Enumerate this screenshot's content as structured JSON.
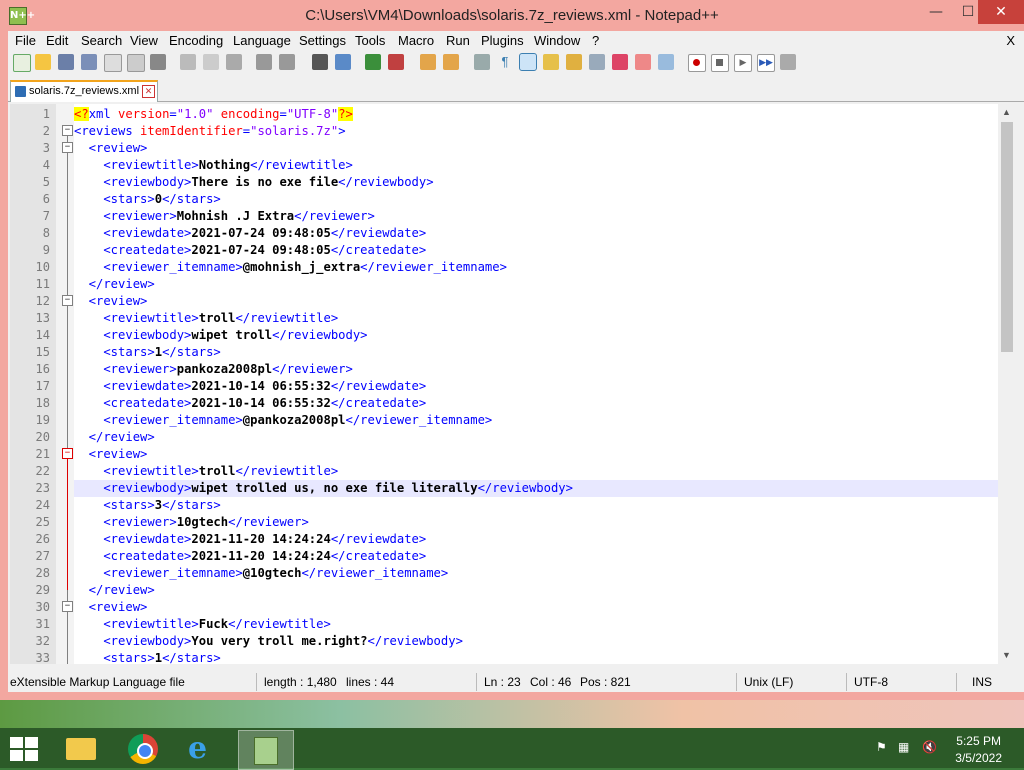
{
  "window": {
    "title": "C:\\Users\\VM4\\Downloads\\solaris.7z_reviews.xml - Notepad++",
    "app_icon": "N++",
    "controls": {
      "minimize": "—",
      "maximize": "☐",
      "close": "✕"
    }
  },
  "menu": {
    "items": [
      "File",
      "Edit",
      "Search",
      "View",
      "Encoding",
      "Language",
      "Settings",
      "Tools",
      "Macro",
      "Run",
      "Plugins",
      "Window",
      "?"
    ],
    "close_x": "X"
  },
  "tab": {
    "label": "solaris.7z_reviews.xml",
    "close": "✕"
  },
  "editor": {
    "highlighted_line": 23,
    "lines": [
      {
        "n": "1",
        "tokens": [
          [
            "pi",
            "<?"
          ],
          [
            "tag",
            "xml "
          ],
          [
            "attr",
            "version"
          ],
          [
            "tag",
            "="
          ],
          [
            "val",
            "\"1.0\""
          ],
          [
            "tag",
            " "
          ],
          [
            "attr",
            "encoding"
          ],
          [
            "tag",
            "="
          ],
          [
            "val",
            "\"UTF-8\""
          ],
          [
            "pi",
            "?>"
          ]
        ]
      },
      {
        "n": "2",
        "tokens": [
          [
            "tag",
            "<reviews "
          ],
          [
            "attr",
            "itemIdentifier"
          ],
          [
            "tag",
            "="
          ],
          [
            "val",
            "\"solaris.7z\""
          ],
          [
            "tag",
            ">"
          ]
        ]
      },
      {
        "n": "3",
        "tokens": [
          [
            "tag",
            "  <review>"
          ]
        ]
      },
      {
        "n": "4",
        "tokens": [
          [
            "tag",
            "    <reviewtitle>"
          ],
          [
            "txt",
            "Nothing"
          ],
          [
            "tag",
            "</reviewtitle>"
          ]
        ]
      },
      {
        "n": "5",
        "tokens": [
          [
            "tag",
            "    <reviewbody>"
          ],
          [
            "txt",
            "There is no exe file"
          ],
          [
            "tag",
            "</reviewbody>"
          ]
        ]
      },
      {
        "n": "6",
        "tokens": [
          [
            "tag",
            "    <stars>"
          ],
          [
            "txt",
            "0"
          ],
          [
            "tag",
            "</stars>"
          ]
        ]
      },
      {
        "n": "7",
        "tokens": [
          [
            "tag",
            "    <reviewer>"
          ],
          [
            "txt",
            "Mohnish .J Extra"
          ],
          [
            "tag",
            "</reviewer>"
          ]
        ]
      },
      {
        "n": "8",
        "tokens": [
          [
            "tag",
            "    <reviewdate>"
          ],
          [
            "txt",
            "2021-07-24 09:48:05"
          ],
          [
            "tag",
            "</reviewdate>"
          ]
        ]
      },
      {
        "n": "9",
        "tokens": [
          [
            "tag",
            "    <createdate>"
          ],
          [
            "txt",
            "2021-07-24 09:48:05"
          ],
          [
            "tag",
            "</createdate>"
          ]
        ]
      },
      {
        "n": "10",
        "tokens": [
          [
            "tag",
            "    <reviewer_itemname>"
          ],
          [
            "txt",
            "@mohnish_j_extra"
          ],
          [
            "tag",
            "</reviewer_itemname>"
          ]
        ]
      },
      {
        "n": "11",
        "tokens": [
          [
            "tag",
            "  </review>"
          ]
        ]
      },
      {
        "n": "12",
        "tokens": [
          [
            "tag",
            "  <review>"
          ]
        ]
      },
      {
        "n": "13",
        "tokens": [
          [
            "tag",
            "    <reviewtitle>"
          ],
          [
            "txt",
            "troll"
          ],
          [
            "tag",
            "</reviewtitle>"
          ]
        ]
      },
      {
        "n": "14",
        "tokens": [
          [
            "tag",
            "    <reviewbody>"
          ],
          [
            "txt",
            "wipet troll"
          ],
          [
            "tag",
            "</reviewbody>"
          ]
        ]
      },
      {
        "n": "15",
        "tokens": [
          [
            "tag",
            "    <stars>"
          ],
          [
            "txt",
            "1"
          ],
          [
            "tag",
            "</stars>"
          ]
        ]
      },
      {
        "n": "16",
        "tokens": [
          [
            "tag",
            "    <reviewer>"
          ],
          [
            "txt",
            "pankoza2008pl"
          ],
          [
            "tag",
            "</reviewer>"
          ]
        ]
      },
      {
        "n": "17",
        "tokens": [
          [
            "tag",
            "    <reviewdate>"
          ],
          [
            "txt",
            "2021-10-14 06:55:32"
          ],
          [
            "tag",
            "</reviewdate>"
          ]
        ]
      },
      {
        "n": "18",
        "tokens": [
          [
            "tag",
            "    <createdate>"
          ],
          [
            "txt",
            "2021-10-14 06:55:32"
          ],
          [
            "tag",
            "</createdate>"
          ]
        ]
      },
      {
        "n": "19",
        "tokens": [
          [
            "tag",
            "    <reviewer_itemname>"
          ],
          [
            "txt",
            "@pankoza2008pl"
          ],
          [
            "tag",
            "</reviewer_itemname>"
          ]
        ]
      },
      {
        "n": "20",
        "tokens": [
          [
            "tag",
            "  </review>"
          ]
        ]
      },
      {
        "n": "21",
        "tokens": [
          [
            "tag",
            "  <review>"
          ]
        ]
      },
      {
        "n": "22",
        "tokens": [
          [
            "tag",
            "    <reviewtitle>"
          ],
          [
            "txt",
            "troll"
          ],
          [
            "tag",
            "</reviewtitle>"
          ]
        ]
      },
      {
        "n": "23",
        "tokens": [
          [
            "tag",
            "    <reviewbody>"
          ],
          [
            "txt",
            "wipet trolled us, no exe file literally"
          ],
          [
            "tag",
            "</reviewbody>"
          ]
        ]
      },
      {
        "n": "24",
        "tokens": [
          [
            "tag",
            "    <stars>"
          ],
          [
            "txt",
            "3"
          ],
          [
            "tag",
            "</stars>"
          ]
        ]
      },
      {
        "n": "25",
        "tokens": [
          [
            "tag",
            "    <reviewer>"
          ],
          [
            "txt",
            "10gtech"
          ],
          [
            "tag",
            "</reviewer>"
          ]
        ]
      },
      {
        "n": "26",
        "tokens": [
          [
            "tag",
            "    <reviewdate>"
          ],
          [
            "txt",
            "2021-11-20 14:24:24"
          ],
          [
            "tag",
            "</reviewdate>"
          ]
        ]
      },
      {
        "n": "27",
        "tokens": [
          [
            "tag",
            "    <createdate>"
          ],
          [
            "txt",
            "2021-11-20 14:24:24"
          ],
          [
            "tag",
            "</createdate>"
          ]
        ]
      },
      {
        "n": "28",
        "tokens": [
          [
            "tag",
            "    <reviewer_itemname>"
          ],
          [
            "txt",
            "@10gtech"
          ],
          [
            "tag",
            "</reviewer_itemname>"
          ]
        ]
      },
      {
        "n": "29",
        "tokens": [
          [
            "tag",
            "  </review>"
          ]
        ]
      },
      {
        "n": "30",
        "tokens": [
          [
            "tag",
            "  <review>"
          ]
        ]
      },
      {
        "n": "31",
        "tokens": [
          [
            "tag",
            "    <reviewtitle>"
          ],
          [
            "txt",
            "Fuck"
          ],
          [
            "tag",
            "</reviewtitle>"
          ]
        ]
      },
      {
        "n": "32",
        "tokens": [
          [
            "tag",
            "    <reviewbody>"
          ],
          [
            "txt",
            "You very troll me.right?"
          ],
          [
            "tag",
            "</reviewbody>"
          ]
        ]
      },
      {
        "n": "33",
        "tokens": [
          [
            "tag",
            "    <stars>"
          ],
          [
            "txt",
            "1"
          ],
          [
            "tag",
            "</stars>"
          ]
        ]
      }
    ]
  },
  "status": {
    "filetype": "eXtensible Markup Language file",
    "length": "length : 1,480",
    "lines": "lines : 44",
    "ln": "Ln : 23",
    "col": "Col : 46",
    "pos": "Pos : 821",
    "eol": "Unix (LF)",
    "encoding": "UTF-8",
    "mode": "INS"
  },
  "taskbar": {
    "time": "5:25 PM",
    "date": "3/5/2022",
    "apps": [
      "file-explorer-icon",
      "chrome-icon",
      "internet-explorer-icon",
      "notepad-plus-plus-icon"
    ]
  },
  "colors": {
    "tag": "#0000ff",
    "attr": "#ff0000",
    "val": "#8000ff",
    "highlight": "#e8e8ff",
    "title_bar": "#f3a7a0",
    "close_button": "#c7413b"
  }
}
